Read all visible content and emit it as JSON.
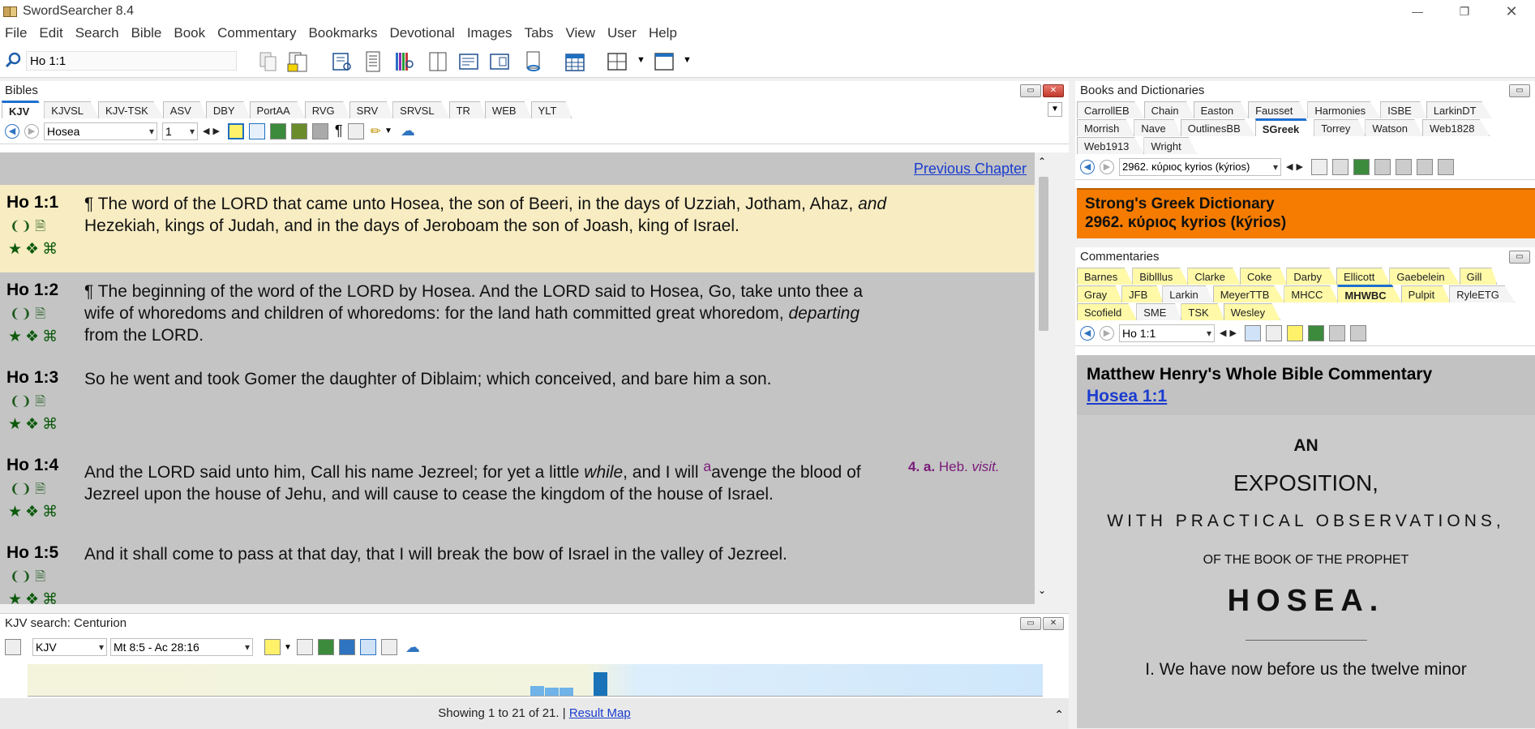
{
  "window": {
    "title": "SwordSearcher 8.4"
  },
  "menu": [
    "File",
    "Edit",
    "Search",
    "Bible",
    "Book",
    "Commentary",
    "Bookmarks",
    "Devotional",
    "Images",
    "Tabs",
    "View",
    "User",
    "Help"
  ],
  "toolbar": {
    "search_value": "Ho 1:1"
  },
  "bibles": {
    "header": "Bibles",
    "tabs": [
      "KJV",
      "KJVSL",
      "KJV-TSK",
      "ASV",
      "DBY",
      "PortAA",
      "RVG",
      "SRV",
      "SRVSL",
      "TR",
      "WEB",
      "YLT"
    ],
    "active_tab": "KJV",
    "book": "Hosea",
    "chapter": "1",
    "prev_chapter": "Previous Chapter",
    "verses": [
      {
        "ref": "Ho 1:1",
        "text_html": "¶ The word of the LORD that came unto Hosea, the son of Beeri, in the days of Uzziah, Jotham, Ahaz, <i>and</i> Hezekiah, kings of Judah, and in the days of Jeroboam the son of Joash, king of Israel."
      },
      {
        "ref": "Ho 1:2",
        "text_html": "¶ The beginning of the word of the LORD by Hosea. And the LORD said to Hosea, Go, take unto thee a wife of whoredoms and children of whoredoms: for the land hath committed great whoredom, <i>departing</i> from the LORD."
      },
      {
        "ref": "Ho 1:3",
        "text_html": "So he went and took Gomer the daughter of Diblaim; which conceived, and bare him a son."
      },
      {
        "ref": "Ho 1:4",
        "text_html": "And the LORD said unto him, Call his name Jezreel; for yet a little <i>while</i>, and I will <sup style=\"color:#7a1a7a\">a</sup>avenge the blood of Jezreel upon the house of Jehu, and will cause to cease the kingdom of the house of Israel."
      },
      {
        "ref": "Ho 1:5",
        "text_html": "And it shall come to pass at that day, that I will break the bow of Israel in the valley of Jezreel."
      }
    ],
    "footnote": {
      "num": "4.",
      "letter": "a.",
      "text": "Heb.",
      "italic": "visit."
    }
  },
  "search": {
    "header": "KJV search: Centurion",
    "version": "KJV",
    "range": "Mt 8:5 - Ac 28:16",
    "status": "Showing 1 to 21 of 21. |",
    "result_map_link": "Result Map",
    "bars": [
      0.3,
      0.25,
      0.25,
      0.75
    ]
  },
  "books": {
    "header": "Books and Dictionaries",
    "tabs_row1": [
      "CarrollEB",
      "Chain",
      "Easton",
      "Fausset",
      "Harmonies",
      "ISBE",
      "LarkinDT"
    ],
    "tabs_row2": [
      "Morrish",
      "Nave",
      "OutlinesBB",
      "SGreek",
      "Torrey",
      "Watson",
      "Web1828"
    ],
    "tabs_row3": [
      "Web1913",
      "Wright"
    ],
    "active_tab": "SGreek",
    "entry_select": "2962. κύριος kyrios (kýrios)",
    "title_line1": "Strong's Greek Dictionary",
    "title_line2": "2962. κύριος kyrios (kýrios)"
  },
  "commentaries": {
    "header": "Commentaries",
    "tabs_row1": [
      "Barnes",
      "Biblllus",
      "Clarke",
      "Coke",
      "Darby",
      "Ellicott",
      "Gaebelein",
      "Gill"
    ],
    "tabs_row2": [
      "Gray",
      "JFB",
      "Larkin",
      "MeyerTTB",
      "MHCC",
      "MHWBC",
      "Pulpit",
      "RyleETG"
    ],
    "tabs_row3": [
      "Scofield",
      "SME",
      "TSK",
      "Wesley"
    ],
    "active_tab": "MHWBC",
    "ref_select": "Ho 1:1",
    "title": "Matthew Henry's Whole Bible Commentary",
    "link": "Hosea 1:1",
    "body": {
      "an": "AN",
      "exposition": "EXPOSITION,",
      "with": "WITH PRACTICAL OBSERVATIONS,",
      "of_the_book": "OF THE BOOK OF THE PROPHET",
      "hosea": "HOSEA.",
      "intro": "I. We have now before us the twelve minor"
    }
  }
}
